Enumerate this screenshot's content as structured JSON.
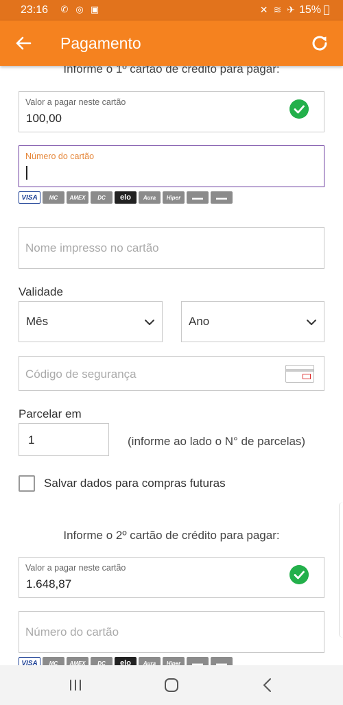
{
  "status": {
    "time": "23:16",
    "notif_icons": [
      "whatsapp-icon",
      "app-icon",
      "photo-icon"
    ],
    "battery": "15%"
  },
  "appbar": {
    "title": "Pagamento"
  },
  "card1": {
    "heading": "Informe o 1º cartão de crédito para pagar:",
    "amount_label": "Valor a pagar neste cartão",
    "amount_value": "100,00",
    "number_label": "Número do cartão",
    "number_value": "",
    "brands": [
      "VISA",
      "MasterCard",
      "American Express",
      "Diners Club",
      "elo",
      "Aura",
      "Hipercard",
      "Card",
      "Card"
    ],
    "name_placeholder": "Nome impresso no cartão",
    "validity_label": "Validade",
    "month_select": "Mês",
    "year_select": "Ano",
    "cvv_placeholder": "Código de segurança",
    "installments_label": "Parcelar em",
    "installments_value": "1",
    "installments_hint": "(informe ao lado o N° de parcelas)",
    "save_label": "Salvar dados para compras futuras"
  },
  "card2": {
    "heading": "Informe o 2º cartão de crédito para pagar:",
    "amount_label": "Valor a pagar neste cartão",
    "amount_value": "1.648,87",
    "number_placeholder": "Número do cartão"
  },
  "colors": {
    "status_bar": "#e2731c",
    "app_bar": "#f5821f",
    "check": "#23b04b",
    "focus_border": "#6a3a9e",
    "focus_label": "#e5873b"
  }
}
